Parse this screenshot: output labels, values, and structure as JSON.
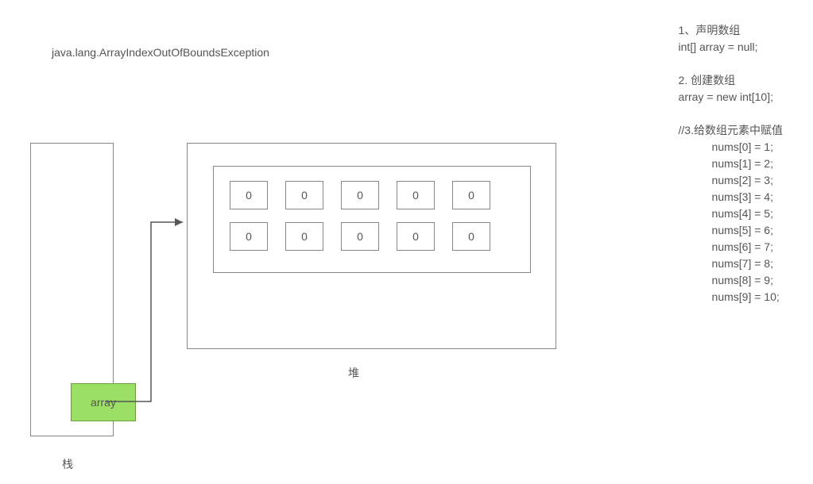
{
  "title": "java.lang.ArrayIndexOutOfBoundsException",
  "stack": {
    "variable": "array",
    "caption": "栈"
  },
  "heap": {
    "caption": "堆",
    "cells": [
      "0",
      "0",
      "0",
      "0",
      "0",
      "0",
      "0",
      "0",
      "0",
      "0"
    ]
  },
  "code": {
    "section1": {
      "title": "1、声明数组",
      "line": "int[] array = null;"
    },
    "section2": {
      "title": "2. 创建数组",
      "line": "array = new int[10];"
    },
    "section3": {
      "title": "//3.给数组元素中赋值",
      "assignments": [
        "nums[0] = 1;",
        "nums[1] = 2;",
        "nums[2] = 3;",
        "nums[3] = 4;",
        "nums[4] = 5;",
        "nums[5] = 6;",
        "nums[6] = 7;",
        "nums[7] = 8;",
        "nums[8] = 9;",
        "nums[9] = 10;"
      ]
    }
  }
}
